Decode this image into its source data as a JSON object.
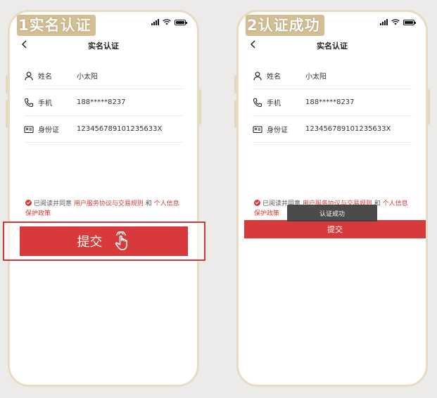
{
  "left": {
    "step_title": "1实名认证",
    "nav_title": "实名认证",
    "rows": [
      {
        "label": "姓名",
        "value": "小太阳"
      },
      {
        "label": "手机",
        "value": "188*****8237"
      },
      {
        "label": "身份证",
        "value": "123456789101235633X"
      }
    ],
    "agreement": {
      "prefix": "已阅读并同意",
      "link1": "用户服务协议与交易规则",
      "and": "和",
      "link2": "个人信息保护政策"
    },
    "submit_label": "提交"
  },
  "right": {
    "step_title": "2认证成功",
    "nav_title": "实名认证",
    "rows": [
      {
        "label": "姓名",
        "value": "小太阳"
      },
      {
        "label": "手机",
        "value": "188*****8237"
      },
      {
        "label": "身份证",
        "value": "123456789101235633X"
      }
    ],
    "agreement": {
      "prefix": "已阅读并同意",
      "link1": "用户服务协议与交易规则",
      "and": "和",
      "link2": "个人信息保护政策"
    },
    "toast": "认证成功",
    "submit_label": "提交"
  },
  "colors": {
    "accent": "#d8393a",
    "frame": "#e7dcc3",
    "background": "#ecebea"
  }
}
